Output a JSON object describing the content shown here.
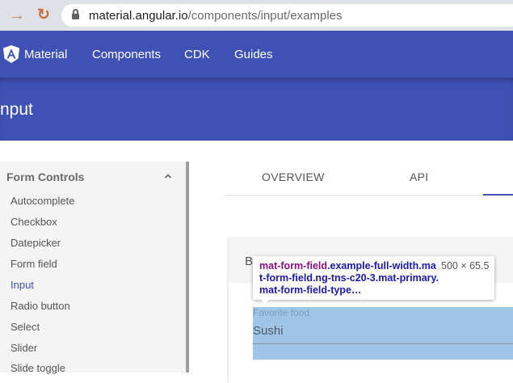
{
  "browser": {
    "forward_glyph": "→",
    "reload_glyph": "↻",
    "url_domain": "material.angular.io",
    "url_path": "/components/input/examples"
  },
  "toolbar": {
    "brand": "Material",
    "nav": [
      "Components",
      "CDK",
      "Guides"
    ],
    "color": "#3f51b5"
  },
  "page": {
    "title": "nput"
  },
  "sidebar": {
    "section_title": "Form Controls",
    "items": [
      {
        "label": "Autocomplete"
      },
      {
        "label": "Checkbox"
      },
      {
        "label": "Datepicker"
      },
      {
        "label": "Form field"
      },
      {
        "label": "Input",
        "active": true
      },
      {
        "label": "Radio button"
      },
      {
        "label": "Select"
      },
      {
        "label": "Slider"
      },
      {
        "label": "Slide toggle"
      }
    ]
  },
  "tabs": {
    "items": [
      "OVERVIEW",
      "API"
    ]
  },
  "example": {
    "title": "B",
    "field_label": "Favorite food",
    "field_value": "Sushi",
    "highlight_color": "#a0c5e8"
  },
  "devtools": {
    "selector_tag": "mat-form-field",
    "selector_rest": ".example-full-width.mat-form-field.ng-tns-c20-3.mat-primary.mat-form-field-type…",
    "dimensions": "500 × 65.5"
  }
}
